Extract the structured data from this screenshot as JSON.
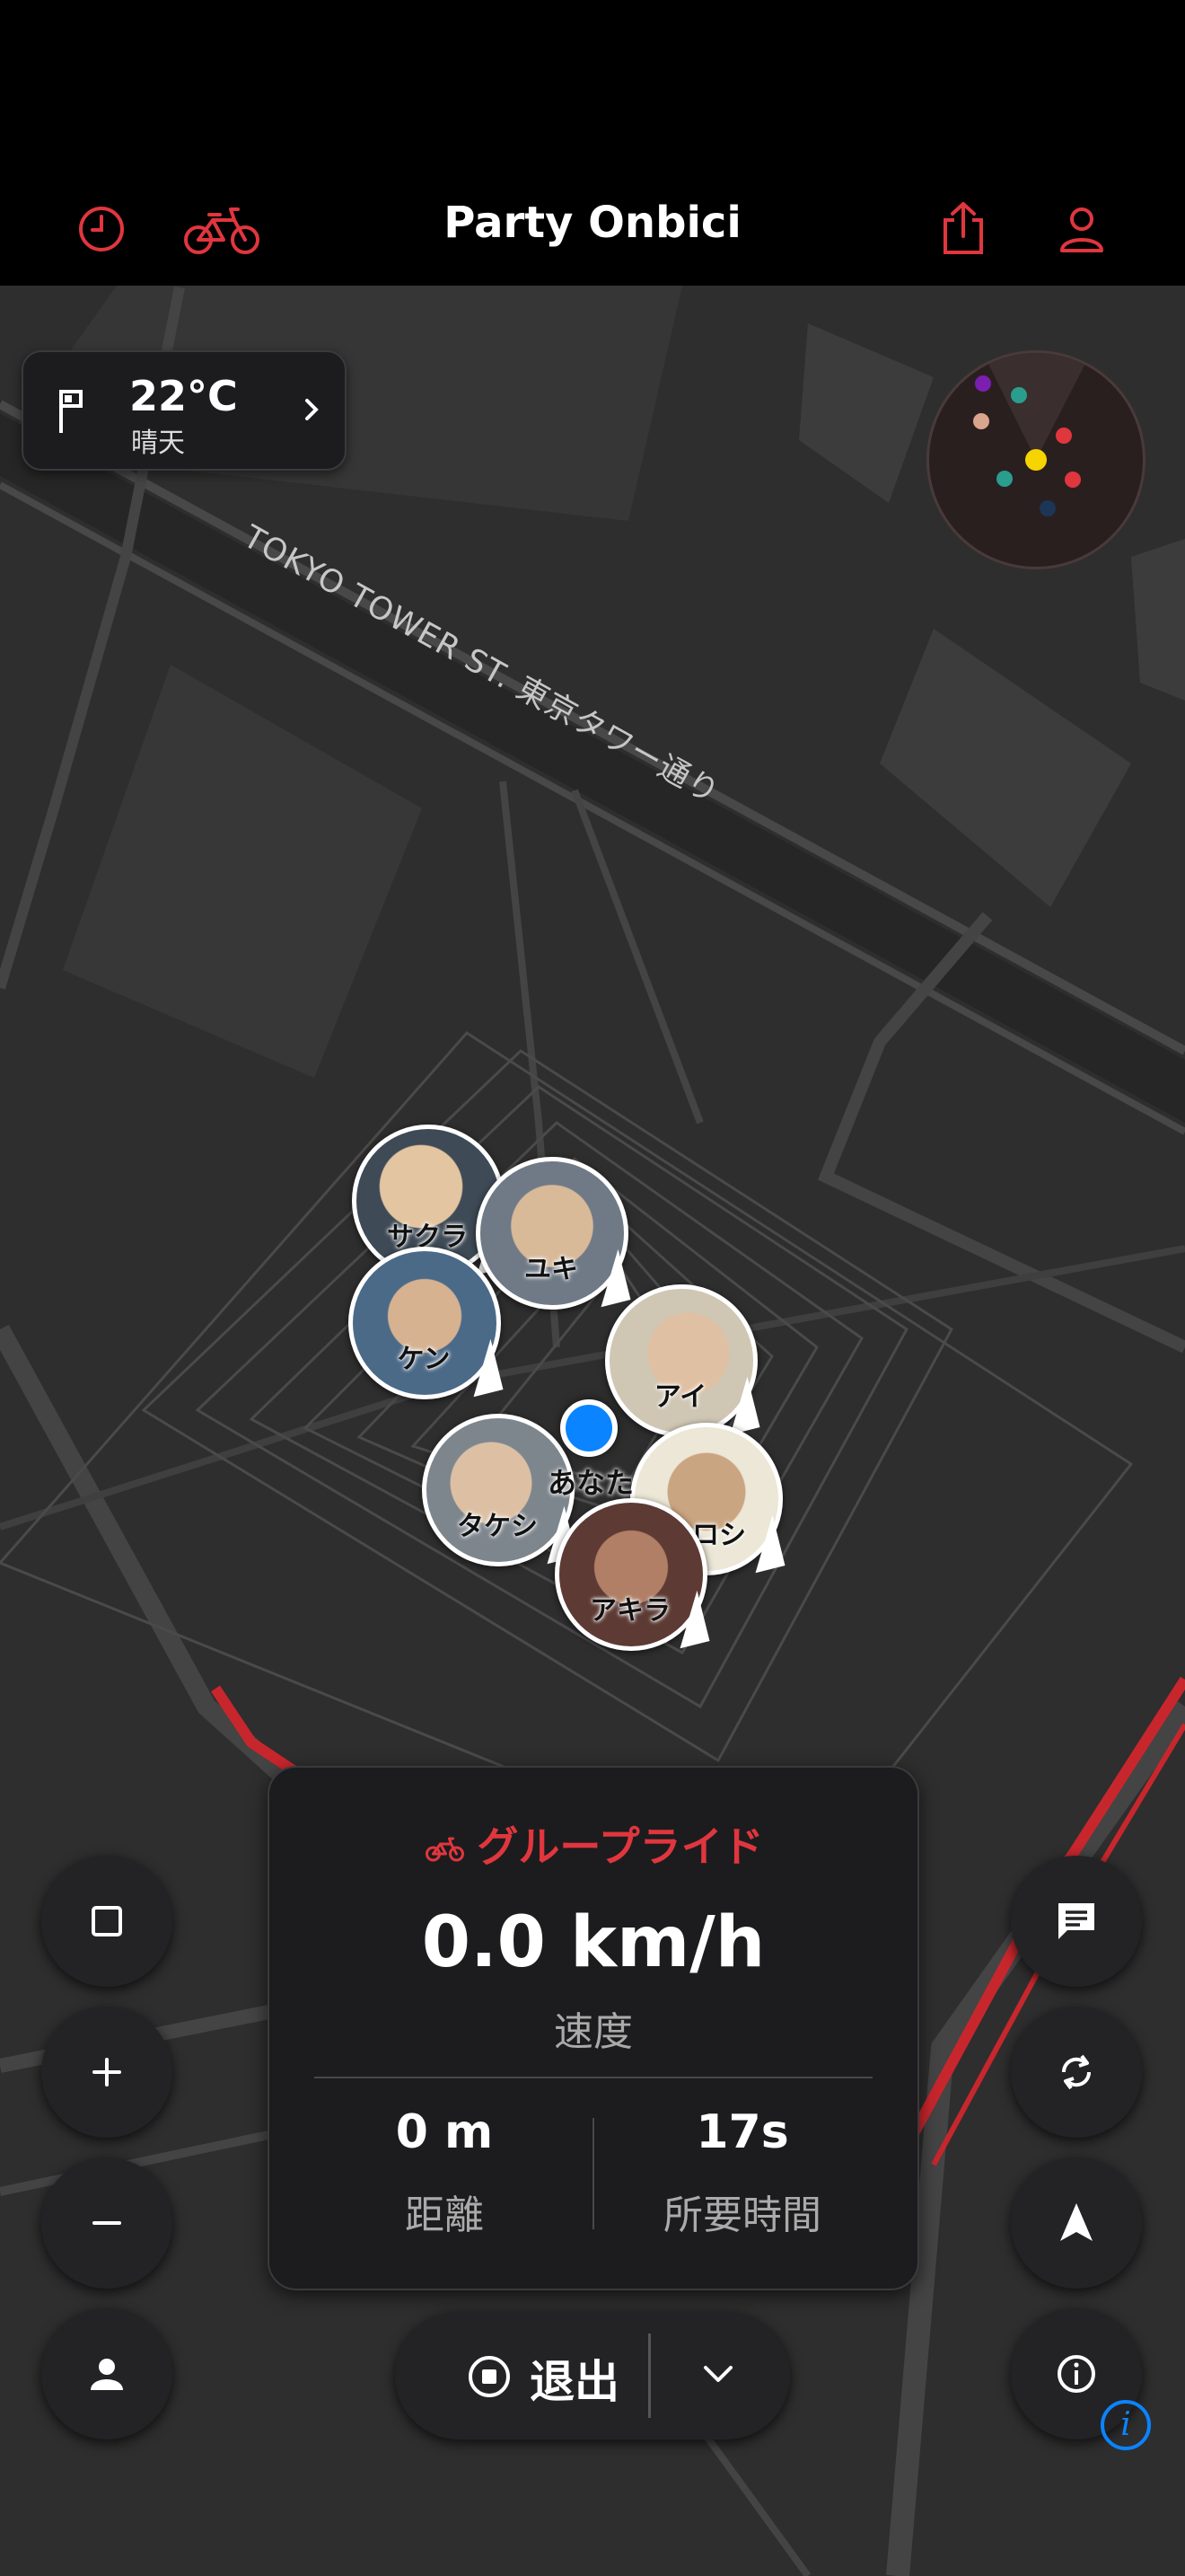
{
  "app": {
    "title": "Party Onbici"
  },
  "header_icons": [
    "history-icon",
    "bike-icon",
    "share-icon",
    "profile-icon"
  ],
  "weather": {
    "temperature": "22°C",
    "condition": "晴天"
  },
  "map": {
    "street_label": "TOKYO TOWER ST. 東京タワー通り"
  },
  "riders": [
    {
      "name": "サクラ",
      "color": "#d9b48c"
    },
    {
      "name": "ユキ",
      "color": "#8c9aa8"
    },
    {
      "name": "ケン",
      "color": "#6b7f92"
    },
    {
      "name": "アイ",
      "color": "#cfc6b4"
    },
    {
      "name": "タケシ",
      "color": "#9aa0a6"
    },
    {
      "name": "ヒロシ",
      "color": "#b89b7a"
    },
    {
      "name": "アキラ",
      "color": "#8a5a4a"
    }
  ],
  "you_label": "あなた",
  "ride_panel": {
    "mode": "グループライド",
    "speed": "0.0 km/h",
    "speed_label": "速度",
    "distance": "0 m",
    "distance_label": "距離",
    "duration": "17s",
    "duration_label": "所要時間"
  },
  "exit_button": {
    "label": "退出"
  },
  "colors": {
    "accent": "#e0363e",
    "location": "#0a84ff",
    "panel": "#1c1c1e",
    "map": "#2e2e2e"
  }
}
